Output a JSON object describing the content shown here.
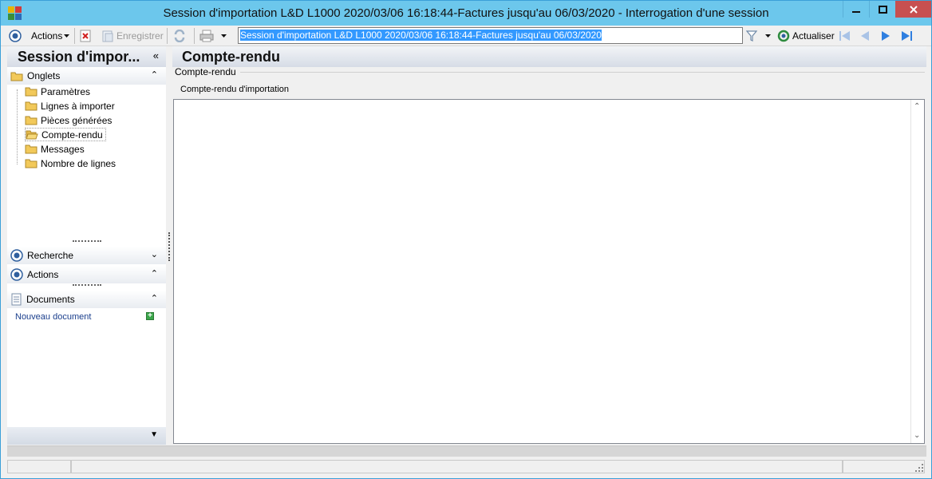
{
  "window": {
    "title": "Session d'importation L&D L1000 2020/03/06 16:18:44-Factures jusqu'au 06/03/2020 -  Interrogation d'une session"
  },
  "toolbar": {
    "actions_label": "Actions",
    "save_label": "Enregistrer",
    "session_value": "Session d'importation L&D L1000 2020/03/06 16:18:44-Factures jusqu'au 06/03/2020",
    "refresh_label": "Actualiser"
  },
  "left_panel": {
    "title": "Session d'impor...",
    "tabs_section": "Onglets",
    "tabs": [
      {
        "label": "Paramètres"
      },
      {
        "label": "Lignes à importer"
      },
      {
        "label": "Pièces générées"
      },
      {
        "label": "Compte-rendu"
      },
      {
        "label": "Messages"
      },
      {
        "label": "Nombre de lignes"
      }
    ],
    "search_section": "Recherche",
    "actions_section": "Actions",
    "documents_section": "Documents",
    "new_document": "Nouveau document"
  },
  "main": {
    "title": "Compte-rendu",
    "group_label": "Compte-rendu",
    "field_label": "Compte-rendu d'importation",
    "report_text": ""
  },
  "colors": {
    "titlebar": "#6cc7ec",
    "close_button": "#c75050",
    "selection": "#3399ff",
    "link": "#1a3e8c"
  }
}
